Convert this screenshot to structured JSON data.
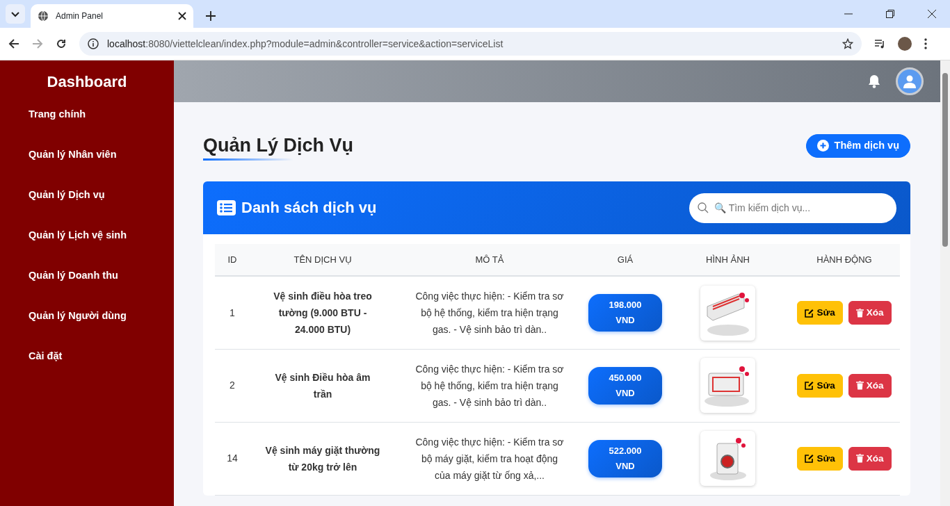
{
  "browser": {
    "tab_title": "Admin Panel",
    "url_host": "localhost",
    "url_rest": ":8080/viettelclean/index.php?module=admin&controller=service&action=serviceList"
  },
  "sidebar": {
    "title": "Dashboard",
    "items": [
      "Trang chính",
      "Quản lý Nhân viên",
      "Quản lý Dịch vụ",
      "Quản lý Lịch vệ sinh",
      "Quản lý Doanh thu",
      "Quản lý Người dùng",
      "Cài đặt"
    ]
  },
  "page": {
    "title": "Quản Lý Dịch Vụ",
    "add_button": "Thêm dịch vụ"
  },
  "panel": {
    "title": "Danh sách dịch vụ",
    "search": {
      "placeholder": "🔍 Tìm kiếm dịch vụ..."
    }
  },
  "table": {
    "columns": [
      "ID",
      "TÊN DỊCH VỤ",
      "MÔ TẢ",
      "GIÁ",
      "HÌNH ẢNH",
      "HÀNH ĐỘNG"
    ],
    "rows": [
      {
        "id": "1",
        "name": "Vệ sinh điều hòa treo tường (9.000 BTU - 24.000 BTU)",
        "description": "Công việc thực hiện: - Kiểm tra sơ bộ hệ thống, kiểm tra hiện trạng gas. - Vệ sinh bảo trì dàn..",
        "price": "198.000 VND",
        "kind": "wall-ac",
        "edit": "Sửa",
        "delete": "Xóa"
      },
      {
        "id": "2",
        "name": "Vệ sinh Điều hòa âm trần",
        "description": "Công việc thực hiện: - Kiểm tra sơ bộ hệ thống, kiểm tra hiện trạng gas. - Vệ sinh bảo trì dàn..",
        "price": "450.000 VND",
        "kind": "ceiling-ac",
        "edit": "Sửa",
        "delete": "Xóa"
      },
      {
        "id": "14",
        "name": "Vệ sinh máy giặt thường từ 20kg trở lên",
        "description": "Công việc thực hiện: - Kiểm tra sơ bộ máy giặt, kiểm tra hoạt động của máy giặt từ ống xả,...",
        "price": "522.000 VND",
        "kind": "washer",
        "edit": "Sửa",
        "delete": "Xóa"
      }
    ]
  }
}
